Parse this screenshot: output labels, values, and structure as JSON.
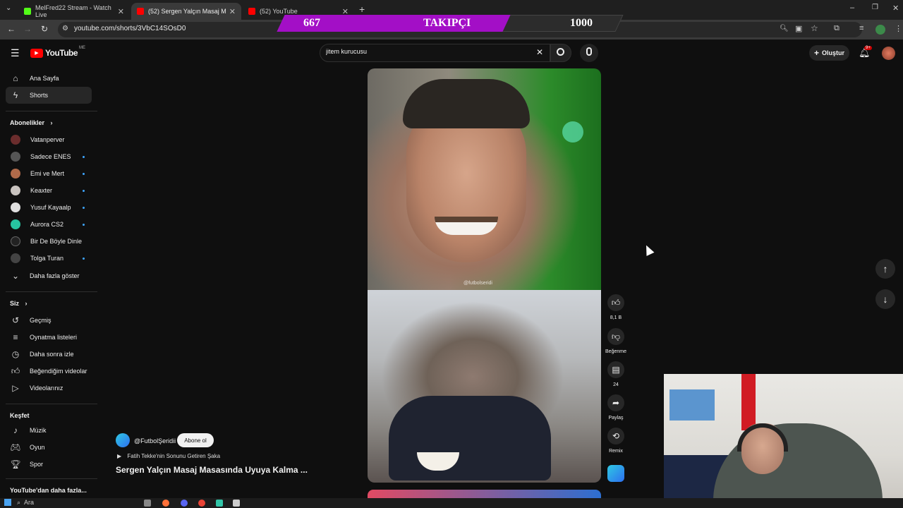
{
  "browser": {
    "tabs": [
      {
        "label": "MelFred22 Stream - Watch Live",
        "favicon_color": "#53fc18"
      },
      {
        "label": "(52) Sergen Yalçın Masaj M",
        "favicon_color": "#ff0000"
      },
      {
        "label": "(52) YouTube",
        "favicon_color": "#ff0000"
      }
    ],
    "new_tab": "+",
    "url": "youtube.com/shorts/3VbC14SOsD0"
  },
  "overlay": {
    "current": "667",
    "label": "TAKIPÇI",
    "goal": "1000",
    "progress": 0.667,
    "fill_color": "#a30fc6"
  },
  "youtube": {
    "logo_text": "YouTube",
    "region": "ME",
    "search_value": "jitem kurucusu",
    "create_label": "Oluştur",
    "notif_count": "9+",
    "accent": "#ff0000"
  },
  "sidebar": {
    "main": [
      {
        "label": "Ana Sayfa",
        "icon": "home-icon"
      },
      {
        "label": "Shorts",
        "icon": "shorts-icon"
      }
    ],
    "subs_header": "Abonelikler",
    "subs": [
      {
        "label": "Vatanperver",
        "color": "#6b2d2d",
        "dot": false
      },
      {
        "label": "Sadece ENES",
        "color": "#555555",
        "dot": true
      },
      {
        "label": "Emi ve Mert",
        "color": "#b06a4a",
        "dot": true
      },
      {
        "label": "Keaxter",
        "color": "#c9c3bf",
        "dot": true
      },
      {
        "label": "Yusuf Kayaalp",
        "color": "#e0e0e0",
        "dot": true
      },
      {
        "label": "Aurora CS2",
        "color": "#27c3a0",
        "dot": true
      },
      {
        "label": "Bir De Böyle Dinle",
        "color": "#222222",
        "dot": false
      },
      {
        "label": "Tolga Turan",
        "color": "#444444",
        "dot": true
      }
    ],
    "show_more": "Daha fazla göster",
    "you_header": "Siz",
    "you": [
      {
        "label": "Geçmiş",
        "icon": "history-icon"
      },
      {
        "label": "Oynatma listeleri",
        "icon": "playlist-icon"
      },
      {
        "label": "Daha sonra izle",
        "icon": "watch-later-icon"
      },
      {
        "label": "Beğendiğim videolar",
        "icon": "like-icon"
      },
      {
        "label": "Videolarınız",
        "icon": "video-icon"
      }
    ],
    "explore_header": "Keşfet",
    "explore": [
      {
        "label": "Müzik",
        "icon": "music-icon"
      },
      {
        "label": "Oyun",
        "icon": "gaming-icon"
      },
      {
        "label": "Spor",
        "icon": "trophy-icon"
      }
    ],
    "more_header": "YouTube'dan daha fazla..."
  },
  "short": {
    "watermark": "@futbolseridi",
    "channel": "@FutbolŞeridii",
    "subscribe": "Abone ol",
    "music": "Fatih Tekke'nin Sonunu Getiren Şaka",
    "title": "Sergen Yalçın Masaj Masasında Uyuya Kalma ...",
    "likes": "8,1 B",
    "dislike_label": "Beğenme",
    "comments": "24",
    "share_label": "Paylaş",
    "remix_label": "Remix"
  },
  "taskbar": {
    "search_placeholder": "Ara"
  }
}
